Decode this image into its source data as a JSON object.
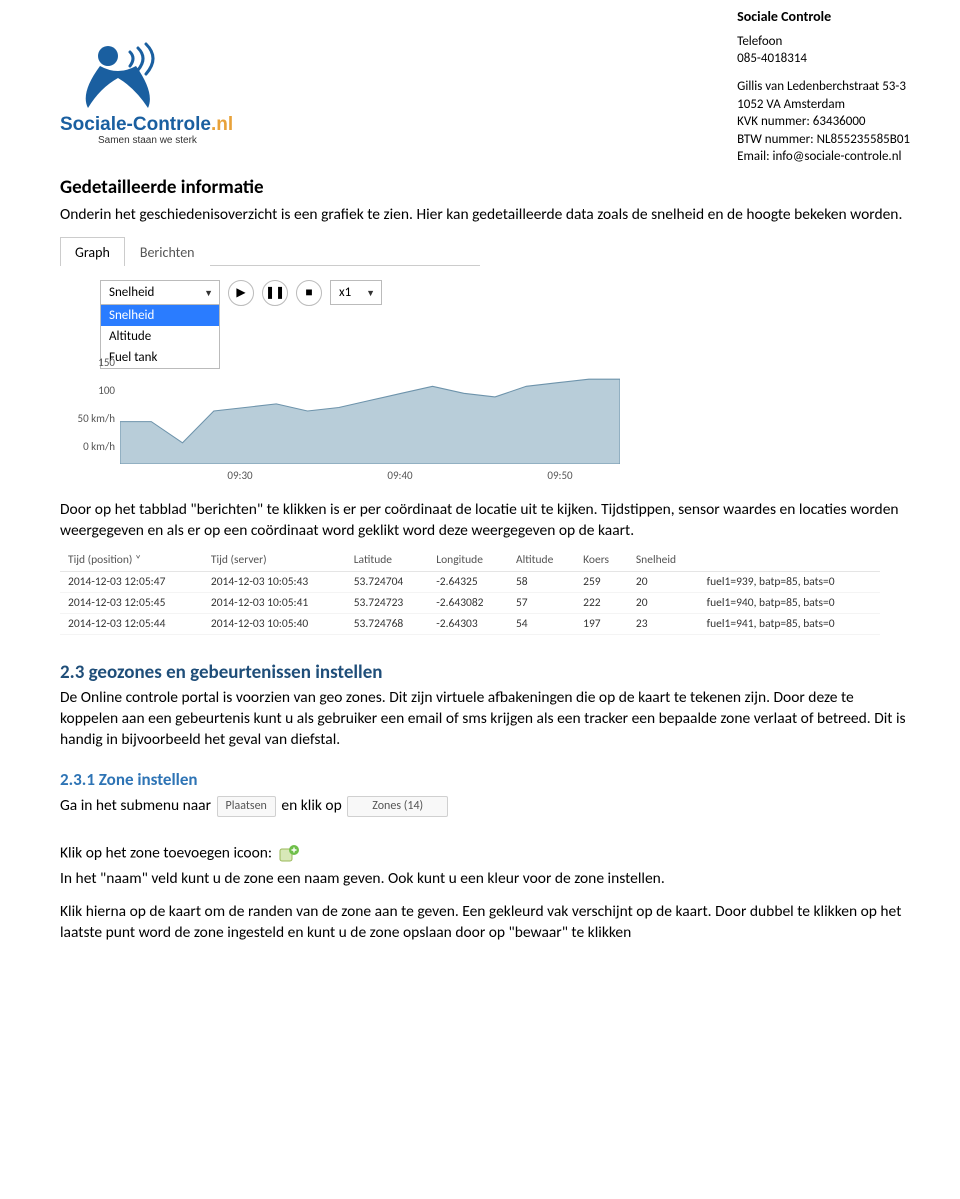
{
  "company": {
    "name": "Sociale Controle",
    "phone_label": "Telefoon",
    "phone": "085-4018314",
    "address1": "Gillis van Ledenberchstraat 53-3",
    "address2": "1052 VA Amsterdam",
    "kvk": "KVK nummer: 63436000",
    "btw": "BTW nummer: NL855235585B01",
    "email": "Email: info@sociale-controle.nl"
  },
  "logo": {
    "brand": "Sociale-Controle",
    "tld": ".nl",
    "tagline": "Samen staan we sterk"
  },
  "section1": {
    "heading": "Gedetailleerde informatie",
    "p1": "Onderin het geschiedenisoverzicht is een grafiek te zien. Hier kan gedetailleerde data zoals de snelheid en de hoogte bekeken worden."
  },
  "graph_ui": {
    "tab_graph": "Graph",
    "tab_berichten": "Berichten",
    "dropdown_selected": "Snelheid",
    "dropdown_options": [
      "Snelheid",
      "Altitude",
      "Fuel tank"
    ],
    "speed": "x1",
    "y_ticks": [
      "150",
      "100",
      "50 km/h",
      "0 km/h"
    ],
    "x_ticks": [
      "09:30",
      "09:40",
      "09:50"
    ]
  },
  "chart_data": {
    "type": "line",
    "title": "",
    "xlabel": "",
    "ylabel": "km/h",
    "ylim": [
      0,
      150
    ],
    "x": [
      "09:25",
      "09:27",
      "09:29",
      "09:30",
      "09:31",
      "09:33",
      "09:35",
      "09:37",
      "09:39",
      "09:40",
      "09:42",
      "09:44",
      "09:46",
      "09:48",
      "09:50",
      "09:52",
      "09:54"
    ],
    "values": [
      60,
      60,
      30,
      75,
      80,
      85,
      75,
      80,
      90,
      100,
      110,
      100,
      95,
      110,
      115,
      120,
      120
    ]
  },
  "section2": {
    "p1": "Door op het tabblad \"berichten\" te klikken is er per coördinaat de locatie uit te kijken. Tijdstippen, sensor waardes en locaties worden weergegeven en als er op een coördinaat word geklikt word deze weergegeven op de kaart."
  },
  "table": {
    "headers": [
      "Tijd (position) ˅",
      "Tijd (server)",
      "Latitude",
      "Longitude",
      "Altitude",
      "Koers",
      "Snelheid",
      ""
    ],
    "rows": [
      [
        "2014-12-03 12:05:47",
        "2014-12-03 10:05:43",
        "53.724704",
        "-2.64325",
        "58",
        "259",
        "20",
        "fuel1=939, batp=85, bats=0"
      ],
      [
        "2014-12-03 12:05:45",
        "2014-12-03 10:05:41",
        "53.724723",
        "-2.643082",
        "57",
        "222",
        "20",
        "fuel1=940, batp=85, bats=0"
      ],
      [
        "2014-12-03 12:05:44",
        "2014-12-03 10:05:40",
        "53.724768",
        "-2.64303",
        "54",
        "197",
        "23",
        "fuel1=941, batp=85, bats=0"
      ]
    ]
  },
  "section3": {
    "heading": "2.3 geozones en gebeurtenissen instellen",
    "p1": "De Online controle portal is voorzien van geo zones. Dit zijn virtuele afbakeningen die op de kaart te tekenen zijn. Door deze te koppelen aan een gebeurtenis kunt u als gebruiker een email of sms krijgen als een tracker een bepaalde zone verlaat of betreed. Dit is handig in bijvoorbeeld het geval van diefstal."
  },
  "section4": {
    "heading": "2.3.1 Zone instellen",
    "line1_a": "Ga in het submenu naar ",
    "chip_plaatsen": "Plaatsen",
    "line1_b": " en klik op ",
    "chip_zones": "Zones (14)"
  },
  "section5": {
    "line1": "Klik op het zone toevoegen icoon: ",
    "line2": "In het \"naam\" veld kunt u de zone een naam geven. Ook kunt u een kleur voor de zone instellen.",
    "line3": "Klik hierna op de kaart om de randen van de zone aan te geven. Een gekleurd vak verschijnt op de kaart. Door dubbel te klikken op het laatste punt word de zone ingesteld en kunt u de zone opslaan door op \"bewaar\" te klikken"
  }
}
